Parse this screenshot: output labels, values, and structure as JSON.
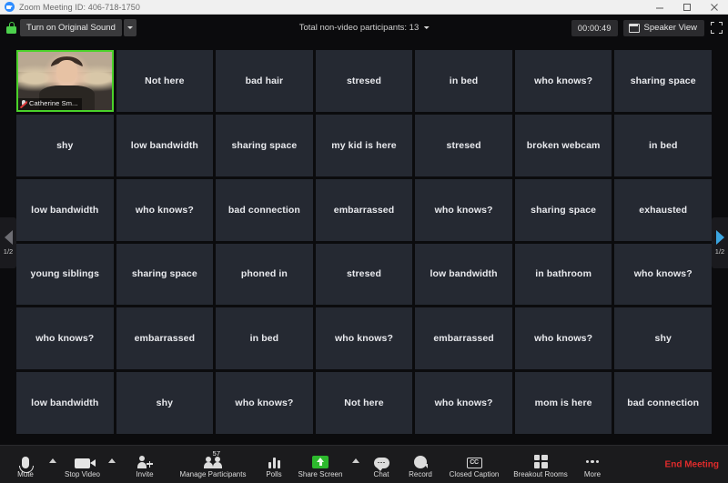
{
  "window": {
    "title": "Zoom Meeting ID: 406-718-1750",
    "logo_icon": "zoom-logo-icon",
    "minimize_icon": "minimize-icon",
    "maximize_icon": "maximize-icon",
    "close_icon": "close-icon"
  },
  "topbar": {
    "lock_icon": "lock-icon",
    "original_sound_label": "Turn on Original Sound",
    "original_sound_caret_icon": "chevron-down-icon",
    "non_video_label": "Total non-video participants: 13",
    "non_video_caret_icon": "chevron-down-icon",
    "timer": "00:00:49",
    "view_label": "Speaker View",
    "view_icon": "speaker-view-icon",
    "fullscreen_icon": "fullscreen-icon"
  },
  "stage": {
    "pager_left": {
      "arrow_icon": "chevron-left-icon",
      "page_label": "1/2"
    },
    "pager_right": {
      "arrow_icon": "chevron-right-icon",
      "page_label": "1/2"
    },
    "video_tile": {
      "participant_name": "Catherine Sm...",
      "mic_icon": "microphone-muted-icon",
      "is_active_speaker": true,
      "active_border_color": "#4ad22a"
    },
    "tiles": [
      "Not here",
      "bad hair",
      "stresed",
      "in bed",
      "who knows?",
      "sharing space",
      "shy",
      "low bandwidth",
      "sharing space",
      "my kid is here",
      "stresed",
      "broken webcam",
      "in bed",
      "low bandwidth",
      "who knows?",
      "bad connection",
      "embarrassed",
      "who knows?",
      "sharing space",
      "exhausted",
      "young siblings",
      "sharing space",
      "phoned in",
      "stresed",
      "low bandwidth",
      "in bathroom",
      "who knows?",
      "who knows?",
      "embarrassed",
      "in bed",
      "who knows?",
      "embarrassed",
      "who knows?",
      "shy",
      "low bandwidth",
      "shy",
      "who knows?",
      "Not here",
      "who knows?",
      "mom is here",
      "bad connection"
    ],
    "tile_background": "#252932"
  },
  "toolbar": {
    "items": [
      {
        "label": "Mute",
        "icon": "microphone-icon",
        "has_caret": true
      },
      {
        "label": "Stop Video",
        "icon": "video-camera-icon",
        "has_caret": true
      },
      {
        "label": "Invite",
        "icon": "invite-person-icon",
        "has_caret": false
      },
      {
        "label": "Manage Participants",
        "icon": "participants-icon",
        "has_caret": false,
        "badge": "57"
      },
      {
        "label": "Polls",
        "icon": "poll-bars-icon",
        "has_caret": false
      },
      {
        "label": "Share Screen",
        "icon": "share-screen-icon",
        "has_caret": true
      },
      {
        "label": "Chat",
        "icon": "chat-bubble-icon",
        "has_caret": false
      },
      {
        "label": "Record",
        "icon": "record-icon",
        "has_caret": false
      },
      {
        "label": "Closed Caption",
        "icon": "closed-caption-icon",
        "has_caret": false
      },
      {
        "label": "Breakout Rooms",
        "icon": "breakout-rooms-icon",
        "has_caret": false
      },
      {
        "label": "More",
        "icon": "more-dots-icon",
        "has_caret": false
      }
    ],
    "end_meeting_label": "End Meeting",
    "end_meeting_color": "#e02b2b",
    "share_screen_color": "#2db92d"
  }
}
